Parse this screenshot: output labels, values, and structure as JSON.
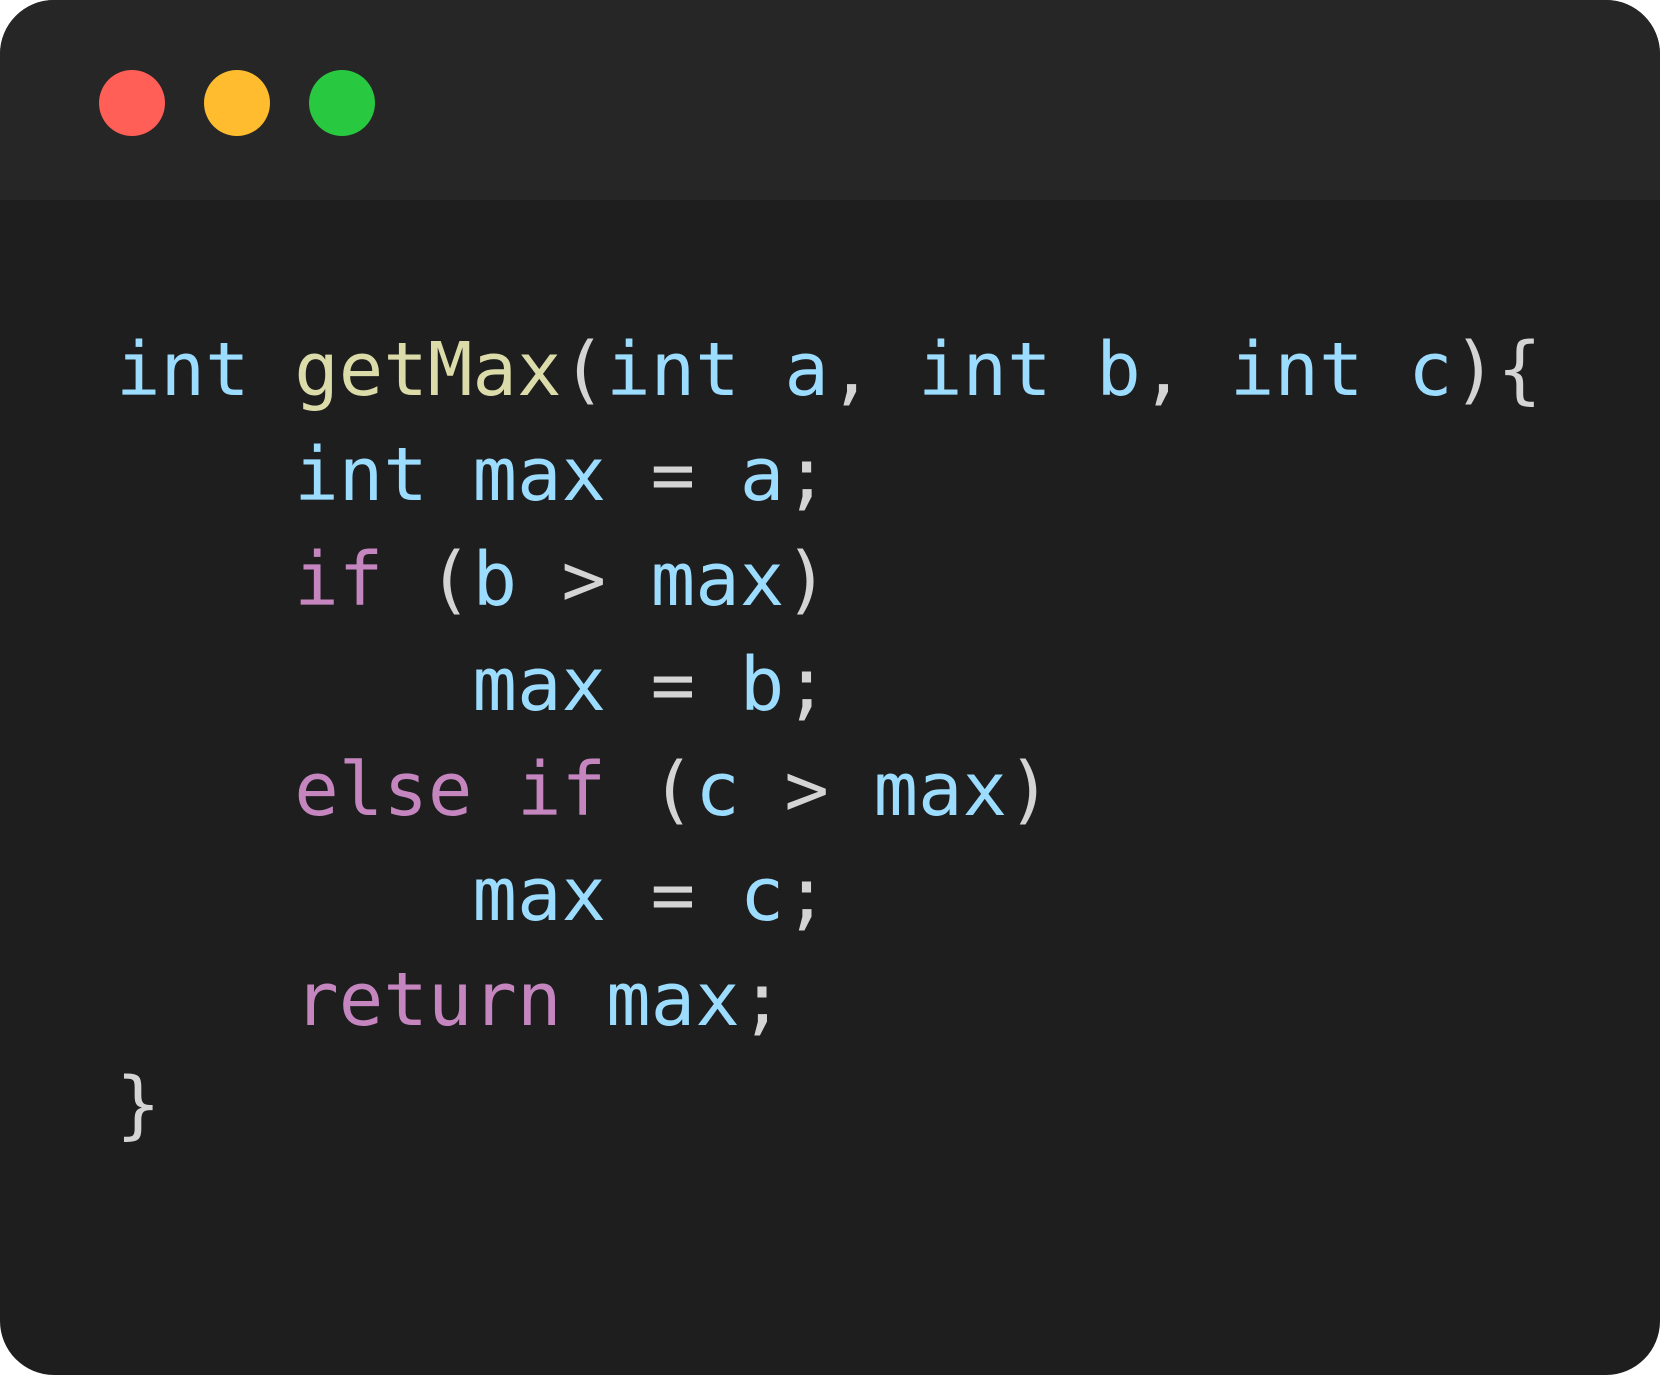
{
  "colors": {
    "window_bg": "#1e1e1e",
    "titlebar_bg": "#262626",
    "close": "#ff5f57",
    "minimize": "#febc2e",
    "maximize": "#28c840",
    "type": "#9cdcfe",
    "ident": "#9cdcfe",
    "function": "#dcdcaa",
    "keyword": "#c586c0",
    "punct": "#d4d4d4"
  },
  "titlebar": {
    "buttons": [
      {
        "name": "close-button",
        "color_key": "close"
      },
      {
        "name": "minimize-button",
        "color_key": "minimize"
      },
      {
        "name": "maximize-button",
        "color_key": "maximize"
      }
    ]
  },
  "code": {
    "lines": [
      [
        {
          "t": "int",
          "k": "type"
        },
        {
          "t": " ",
          "k": "punct"
        },
        {
          "t": "getMax",
          "k": "function"
        },
        {
          "t": "(",
          "k": "punct"
        },
        {
          "t": "int",
          "k": "type"
        },
        {
          "t": " ",
          "k": "punct"
        },
        {
          "t": "a",
          "k": "ident"
        },
        {
          "t": ", ",
          "k": "punct"
        },
        {
          "t": "int",
          "k": "type"
        },
        {
          "t": " ",
          "k": "punct"
        },
        {
          "t": "b",
          "k": "ident"
        },
        {
          "t": ", ",
          "k": "punct"
        },
        {
          "t": "int",
          "k": "type"
        },
        {
          "t": " ",
          "k": "punct"
        },
        {
          "t": "c",
          "k": "ident"
        },
        {
          "t": "){",
          "k": "punct"
        }
      ],
      [
        {
          "t": "    ",
          "k": "punct"
        },
        {
          "t": "int",
          "k": "type"
        },
        {
          "t": " ",
          "k": "punct"
        },
        {
          "t": "max",
          "k": "ident"
        },
        {
          "t": " = ",
          "k": "punct"
        },
        {
          "t": "a",
          "k": "ident"
        },
        {
          "t": ";",
          "k": "punct"
        }
      ],
      [
        {
          "t": "    ",
          "k": "punct"
        },
        {
          "t": "if",
          "k": "keyword"
        },
        {
          "t": " (",
          "k": "punct"
        },
        {
          "t": "b",
          "k": "ident"
        },
        {
          "t": " > ",
          "k": "punct"
        },
        {
          "t": "max",
          "k": "ident"
        },
        {
          "t": ")",
          "k": "punct"
        }
      ],
      [
        {
          "t": "        ",
          "k": "punct"
        },
        {
          "t": "max",
          "k": "ident"
        },
        {
          "t": " = ",
          "k": "punct"
        },
        {
          "t": "b",
          "k": "ident"
        },
        {
          "t": ";",
          "k": "punct"
        }
      ],
      [
        {
          "t": "    ",
          "k": "punct"
        },
        {
          "t": "else",
          "k": "keyword"
        },
        {
          "t": " ",
          "k": "punct"
        },
        {
          "t": "if",
          "k": "keyword"
        },
        {
          "t": " (",
          "k": "punct"
        },
        {
          "t": "c",
          "k": "ident"
        },
        {
          "t": " > ",
          "k": "punct"
        },
        {
          "t": "max",
          "k": "ident"
        },
        {
          "t": ")",
          "k": "punct"
        }
      ],
      [
        {
          "t": "        ",
          "k": "punct"
        },
        {
          "t": "max",
          "k": "ident"
        },
        {
          "t": " = ",
          "k": "punct"
        },
        {
          "t": "c",
          "k": "ident"
        },
        {
          "t": ";",
          "k": "punct"
        }
      ],
      [
        {
          "t": "    ",
          "k": "punct"
        },
        {
          "t": "return",
          "k": "keyword"
        },
        {
          "t": " ",
          "k": "punct"
        },
        {
          "t": "max",
          "k": "ident"
        },
        {
          "t": ";",
          "k": "punct"
        }
      ],
      [
        {
          "t": "}",
          "k": "punct"
        }
      ]
    ]
  }
}
